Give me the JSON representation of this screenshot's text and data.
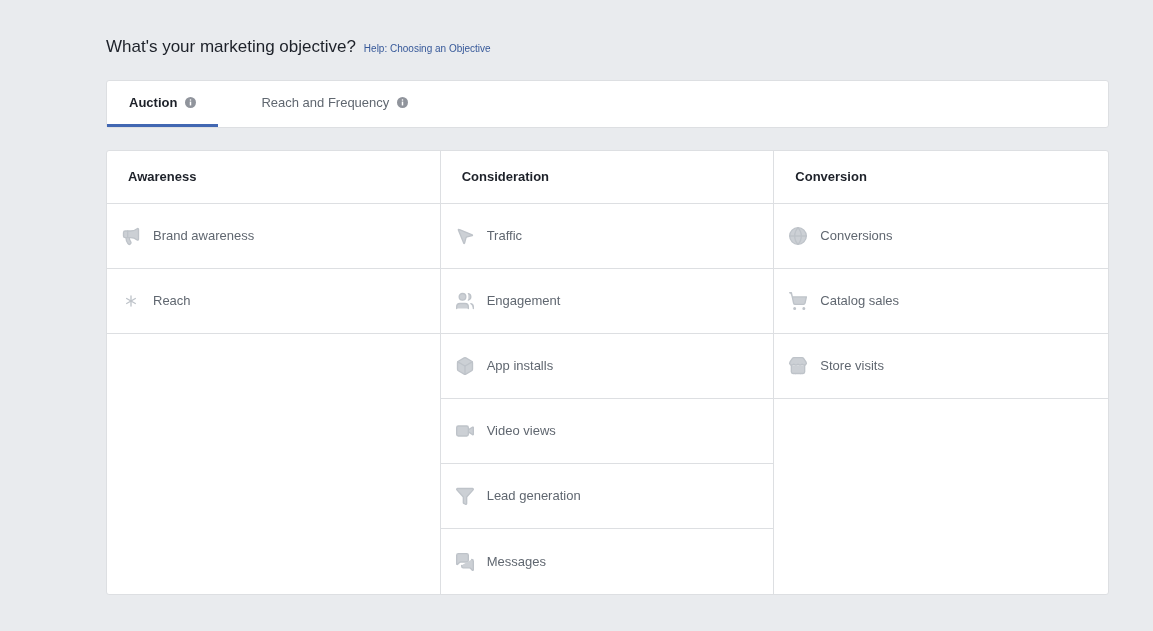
{
  "heading": "What's your marketing objective?",
  "help_link": "Help: Choosing an Objective",
  "tabs": [
    {
      "label": "Auction",
      "selected": true
    },
    {
      "label": "Reach and Frequency",
      "selected": false
    }
  ],
  "columns": [
    {
      "title": "Awareness",
      "items": [
        "Brand awareness",
        "Reach"
      ]
    },
    {
      "title": "Consideration",
      "items": [
        "Traffic",
        "Engagement",
        "App installs",
        "Video views",
        "Lead generation",
        "Messages"
      ]
    },
    {
      "title": "Conversion",
      "items": [
        "Conversions",
        "Catalog sales",
        "Store visits"
      ]
    }
  ]
}
